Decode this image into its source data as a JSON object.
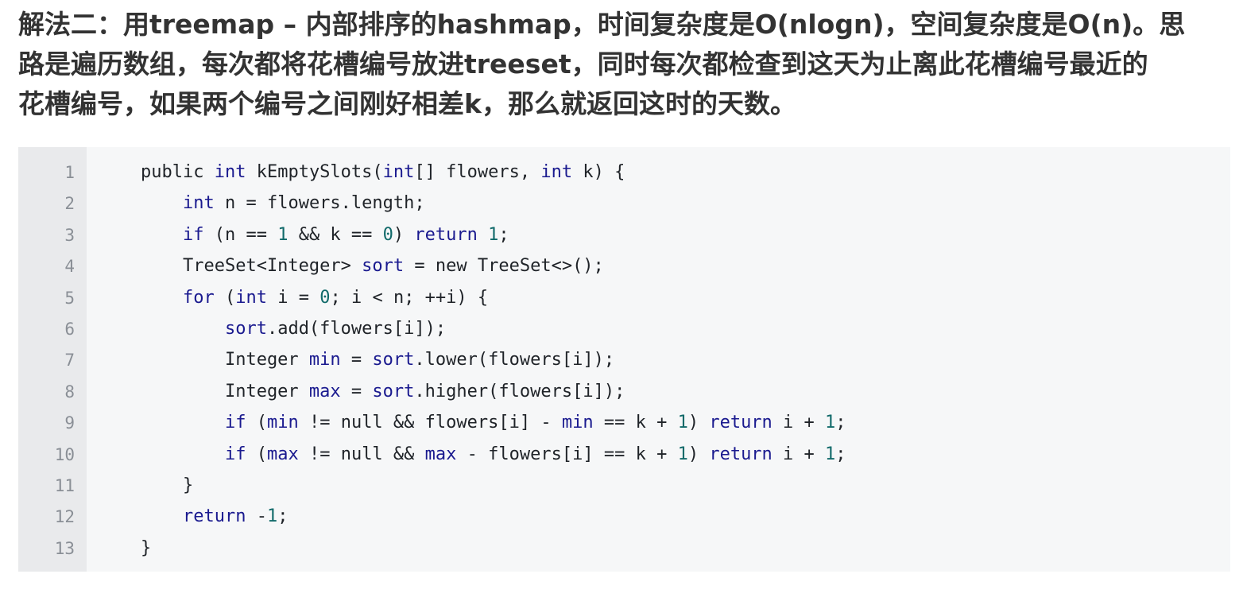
{
  "intro": {
    "lines": [
      "解法二：用treemap – 内部排序的hashmap，时间复杂度是O(nlogn)，空间复杂度是O(n)。思",
      "路是遍历数组，每次都将花槽编号放进treeset，同时每次都检查到这天为止离此花槽编号最近的",
      "花槽编号，如果两个编号之间刚好相差k，那么就返回这时的天数。"
    ]
  },
  "code": {
    "line_numbers": [
      "1",
      "2",
      "3",
      "4",
      "5",
      "6",
      "7",
      "8",
      "9",
      "10",
      "11",
      "12",
      "13"
    ],
    "lines": [
      [
        {
          "t": "public ",
          "c": ""
        },
        {
          "t": "int",
          "c": "kw"
        },
        {
          "t": " kEmptySlots(",
          "c": ""
        },
        {
          "t": "int",
          "c": "kw"
        },
        {
          "t": "[] flowers, ",
          "c": ""
        },
        {
          "t": "int",
          "c": "kw"
        },
        {
          "t": " k) {",
          "c": ""
        }
      ],
      [
        {
          "t": "    ",
          "c": ""
        },
        {
          "t": "int",
          "c": "kw"
        },
        {
          "t": " n = flowers.length;",
          "c": ""
        }
      ],
      [
        {
          "t": "    ",
          "c": ""
        },
        {
          "t": "if",
          "c": "kw"
        },
        {
          "t": " (n == ",
          "c": ""
        },
        {
          "t": "1",
          "c": "num"
        },
        {
          "t": " && k == ",
          "c": ""
        },
        {
          "t": "0",
          "c": "num"
        },
        {
          "t": ") ",
          "c": ""
        },
        {
          "t": "return",
          "c": "kw"
        },
        {
          "t": " ",
          "c": ""
        },
        {
          "t": "1",
          "c": "num"
        },
        {
          "t": ";",
          "c": ""
        }
      ],
      [
        {
          "t": "    TreeSet<Integer> ",
          "c": ""
        },
        {
          "t": "sort",
          "c": "ident"
        },
        {
          "t": " = new TreeSet<>();",
          "c": ""
        }
      ],
      [
        {
          "t": "    ",
          "c": ""
        },
        {
          "t": "for",
          "c": "kw"
        },
        {
          "t": " (",
          "c": ""
        },
        {
          "t": "int",
          "c": "kw"
        },
        {
          "t": " i = ",
          "c": ""
        },
        {
          "t": "0",
          "c": "num"
        },
        {
          "t": "; i < n; ++i) {",
          "c": ""
        }
      ],
      [
        {
          "t": "        ",
          "c": ""
        },
        {
          "t": "sort",
          "c": "ident"
        },
        {
          "t": ".add(flowers[i]);",
          "c": ""
        }
      ],
      [
        {
          "t": "        Integer ",
          "c": ""
        },
        {
          "t": "min",
          "c": "ident"
        },
        {
          "t": " = ",
          "c": ""
        },
        {
          "t": "sort",
          "c": "ident"
        },
        {
          "t": ".lower(flowers[i]);",
          "c": ""
        }
      ],
      [
        {
          "t": "        Integer ",
          "c": ""
        },
        {
          "t": "max",
          "c": "ident"
        },
        {
          "t": " = ",
          "c": ""
        },
        {
          "t": "sort",
          "c": "ident"
        },
        {
          "t": ".higher(flowers[i]);",
          "c": ""
        }
      ],
      [
        {
          "t": "        ",
          "c": ""
        },
        {
          "t": "if",
          "c": "kw"
        },
        {
          "t": " (",
          "c": ""
        },
        {
          "t": "min",
          "c": "ident"
        },
        {
          "t": " != null && flowers[i] - ",
          "c": ""
        },
        {
          "t": "min",
          "c": "ident"
        },
        {
          "t": " == k + ",
          "c": ""
        },
        {
          "t": "1",
          "c": "num"
        },
        {
          "t": ") ",
          "c": ""
        },
        {
          "t": "return",
          "c": "kw"
        },
        {
          "t": " i + ",
          "c": ""
        },
        {
          "t": "1",
          "c": "num"
        },
        {
          "t": ";",
          "c": ""
        }
      ],
      [
        {
          "t": "        ",
          "c": ""
        },
        {
          "t": "if",
          "c": "kw"
        },
        {
          "t": " (",
          "c": ""
        },
        {
          "t": "max",
          "c": "ident"
        },
        {
          "t": " != null && ",
          "c": ""
        },
        {
          "t": "max",
          "c": "ident"
        },
        {
          "t": " - flowers[i] == k + ",
          "c": ""
        },
        {
          "t": "1",
          "c": "num"
        },
        {
          "t": ") ",
          "c": ""
        },
        {
          "t": "return",
          "c": "kw"
        },
        {
          "t": " i + ",
          "c": ""
        },
        {
          "t": "1",
          "c": "num"
        },
        {
          "t": ";",
          "c": ""
        }
      ],
      [
        {
          "t": "    }",
          "c": ""
        }
      ],
      [
        {
          "t": "    ",
          "c": ""
        },
        {
          "t": "return",
          "c": "kw"
        },
        {
          "t": " -",
          "c": ""
        },
        {
          "t": "1",
          "c": "num"
        },
        {
          "t": ";",
          "c": ""
        }
      ],
      [
        {
          "t": "}",
          "c": ""
        }
      ]
    ]
  }
}
